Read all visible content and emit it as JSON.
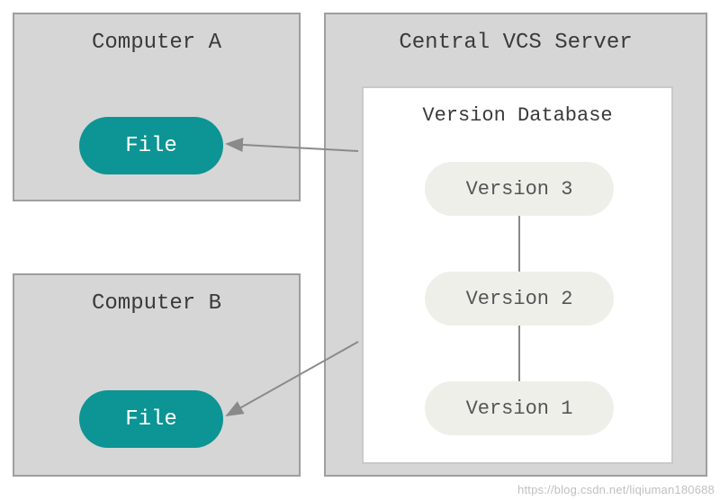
{
  "computer_a": {
    "title": "Computer A",
    "file_label": "File"
  },
  "computer_b": {
    "title": "Computer B",
    "file_label": "File"
  },
  "server": {
    "title": "Central VCS Server",
    "db_title": "Version Database",
    "versions": {
      "v3": "Version 3",
      "v2": "Version 2",
      "v1": "Version 1"
    }
  },
  "watermark": "https://blog.csdn.net/liqiuman180688"
}
